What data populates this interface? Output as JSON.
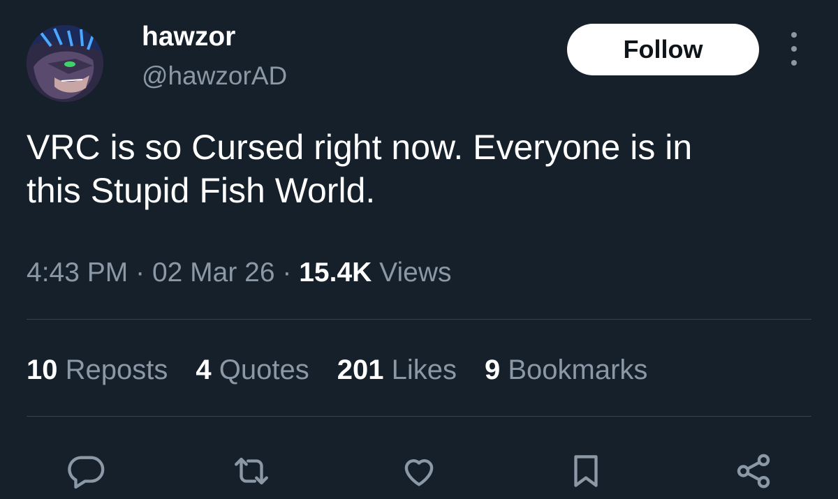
{
  "author": {
    "display_name": "hawzor",
    "handle": "@hawzorAD"
  },
  "follow_label": "Follow",
  "tweet": {
    "text_line1": "VRC is so Cursed right now. Everyone is in",
    "text_line2": "this Stupid Fish World."
  },
  "meta": {
    "time": "4:43 PM",
    "separator": "·",
    "date": "02 Mar 26",
    "views_count": "15.4K",
    "views_label": "Views"
  },
  "stats": [
    {
      "count": "10",
      "label": "Reposts"
    },
    {
      "count": "4",
      "label": "Quotes"
    },
    {
      "count": "201",
      "label": "Likes"
    },
    {
      "count": "9",
      "label": "Bookmarks"
    }
  ],
  "colors": {
    "background": "#15202b",
    "text_primary": "#ffffff",
    "text_secondary": "#8b98a5",
    "divider": "#38444d",
    "button_bg": "#ffffff"
  },
  "icons": [
    "more-vertical-icon",
    "reply-icon",
    "repost-icon",
    "like-icon",
    "bookmark-icon",
    "share-icon"
  ]
}
